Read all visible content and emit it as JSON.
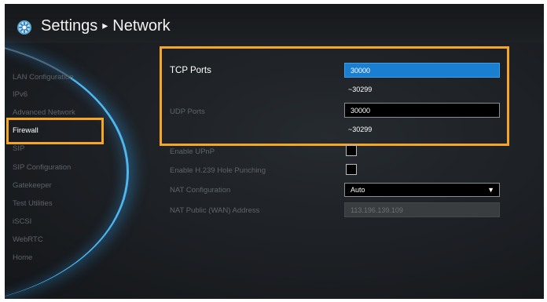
{
  "header": {
    "title": "Settings",
    "separator": "▸",
    "section": "Network",
    "icon": "gear-icon"
  },
  "sidebar": {
    "items": [
      {
        "label": "LAN Configuration"
      },
      {
        "label": "IPv6"
      },
      {
        "label": "Advanced Network"
      },
      {
        "label": "Firewall",
        "active": true
      },
      {
        "label": "SIP"
      },
      {
        "label": "SIP Configuration"
      },
      {
        "label": "Gatekeeper"
      },
      {
        "label": "Test Utilities"
      },
      {
        "label": "iSCSI"
      },
      {
        "label": "WebRTC"
      },
      {
        "label": "Home"
      }
    ]
  },
  "form": {
    "tcp_ports": {
      "label": "TCP Ports",
      "value": "30000",
      "range": "~30299"
    },
    "udp_ports": {
      "label": "UDP Ports",
      "value": "30000",
      "range": "~30299"
    },
    "enable_upnp": {
      "label": "Enable UPnP",
      "checked": false
    },
    "enable_h239": {
      "label": "Enable H.239 Hole Punching",
      "checked": false
    },
    "nat_configuration": {
      "label": "NAT Configuration",
      "value": "Auto",
      "caret": "▼"
    },
    "nat_public_address": {
      "label": "NAT Public (WAN) Address",
      "value": "113.196.139.109"
    }
  },
  "colors": {
    "highlight": "#f5a623",
    "selected_field": "#1a7fd0",
    "arc_glow": "#4fb6f0"
  }
}
